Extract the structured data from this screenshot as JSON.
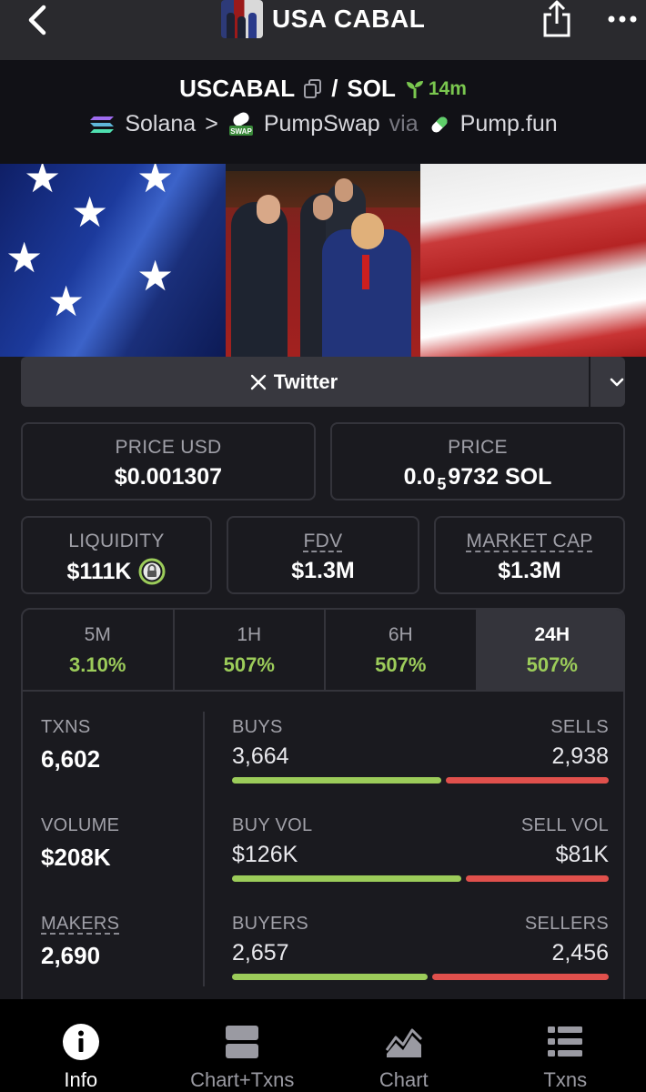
{
  "topbar": {
    "title": "USA CABAL"
  },
  "pair": {
    "base": "USCABAL",
    "separator": "/",
    "quote": "SOL",
    "age": "14m",
    "chain": "Solana",
    "chevron": ">",
    "dex": "PumpSwap",
    "via": "via",
    "launchpad": "Pump.fun"
  },
  "social": {
    "twitter_label": "Twitter"
  },
  "price": {
    "usd_label": "PRICE USD",
    "usd_value": "$0.001307",
    "sol_label": "PRICE",
    "sol_prefix": "0.0",
    "sol_zeros": "5",
    "sol_suffix": "9732 SOL"
  },
  "metrics": {
    "liquidity_label": "LIQUIDITY",
    "liquidity_value": "$111K",
    "fdv_label": "FDV",
    "fdv_value": "$1.3M",
    "mcap_label": "MARKET CAP",
    "mcap_value": "$1.3M"
  },
  "timeframes": [
    {
      "label": "5M",
      "change": "3.10%"
    },
    {
      "label": "1H",
      "change": "507%"
    },
    {
      "label": "6H",
      "change": "507%"
    },
    {
      "label": "24H",
      "change": "507%"
    }
  ],
  "active_timeframe": "24H",
  "stats": {
    "txns_label": "TXNS",
    "txns_value": "6,602",
    "volume_label": "VOLUME",
    "volume_value": "$208K",
    "makers_label": "MAKERS",
    "makers_value": "2,690",
    "buys_label": "BUYS",
    "buys_value": "3,664",
    "sells_label": "SELLS",
    "sells_value": "2,938",
    "buy_vol_label": "BUY VOL",
    "buy_vol_value": "$126K",
    "sell_vol_label": "SELL VOL",
    "sell_vol_value": "$81K",
    "buyers_label": "BUYERS",
    "buyers_value": "2,657",
    "sellers_label": "SELLERS",
    "sellers_value": "2,456",
    "buy_ratio": 0.555,
    "buy_vol_ratio": 0.609,
    "buyers_ratio": 0.52
  },
  "colors": {
    "positive": "#9ccc5a",
    "negative": "#e0504c",
    "age_green": "#7ac74f"
  },
  "nav": {
    "info": "Info",
    "chart_txns": "Chart+Txns",
    "chart": "Chart",
    "txns": "Txns"
  }
}
